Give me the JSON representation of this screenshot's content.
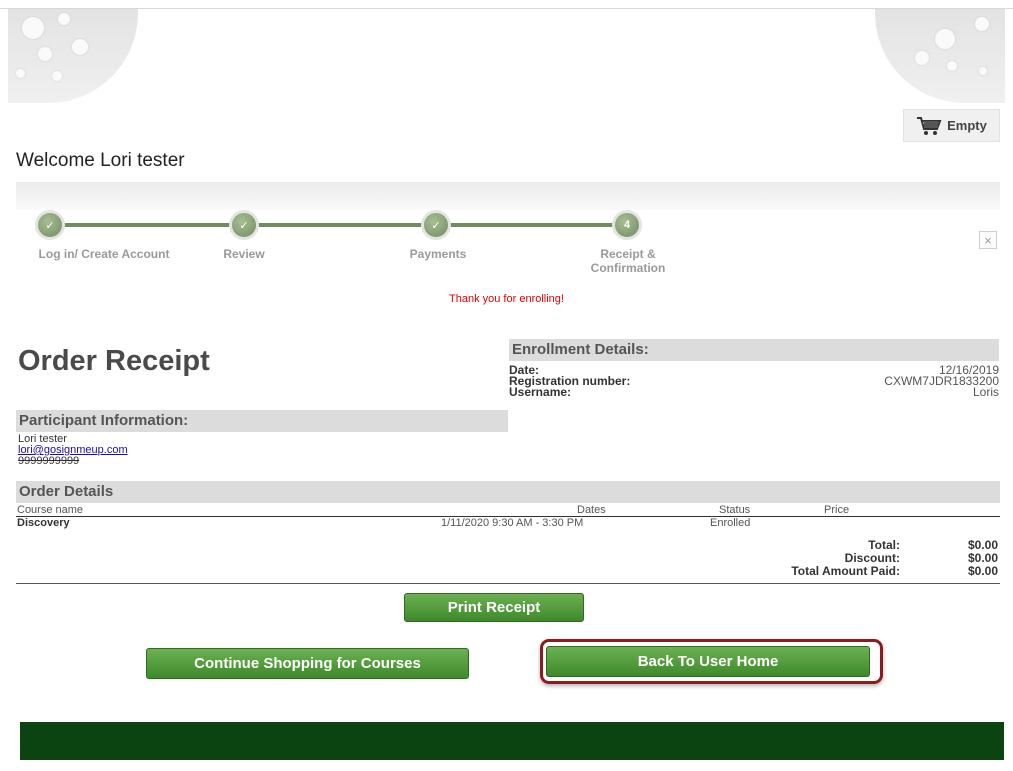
{
  "cart": {
    "label": "Empty"
  },
  "welcome": "Welcome Lori tester",
  "steps": [
    {
      "number": "✓",
      "label": "Log in/ Create Account"
    },
    {
      "number": "✓",
      "label": "Review"
    },
    {
      "number": "✓",
      "label": "Payments"
    },
    {
      "number": "4",
      "label_line1": "Receipt &",
      "label_line2": "Confirmation"
    }
  ],
  "close_glyph": "×",
  "thanks": "Thank you for enrolling!",
  "order_title": "Order Receipt",
  "enrollment": {
    "heading": "Enrollment Details:",
    "rows": [
      {
        "label": "Date:",
        "value": "12/16/2019"
      },
      {
        "label": "Registration number:",
        "value": "CXWM7JDR1833200"
      },
      {
        "label": "Username:",
        "value": "Loris"
      }
    ]
  },
  "participant": {
    "heading": "Participant Information:",
    "name": "Lori tester",
    "email": "lori@gosignmeup.com",
    "phone": "9999999999"
  },
  "order": {
    "heading": "Order Details",
    "columns": {
      "course": "Course name",
      "dates": "Dates",
      "status": "Status",
      "price": "Price"
    },
    "rows": [
      {
        "course": "Discovery",
        "dates": "1/11/2020 9:30 AM - 3:30 PM",
        "status": "Enrolled",
        "price": ""
      }
    ],
    "totals": [
      {
        "label": "Total:",
        "value": "$0.00"
      },
      {
        "label": "Discount:",
        "value": "$0.00"
      },
      {
        "label": "Total Amount Paid:",
        "value": "$0.00"
      }
    ]
  },
  "buttons": {
    "print": "Print Receipt",
    "continue": "Continue Shopping for Courses",
    "back_home": "Back To User Home"
  },
  "colors": {
    "accent_green": "#4a9a35",
    "footer_green": "#0b4410",
    "step_green": "#6f8d5d",
    "thanks_red": "#e00000",
    "highlight_red": "#8a1c1c"
  }
}
